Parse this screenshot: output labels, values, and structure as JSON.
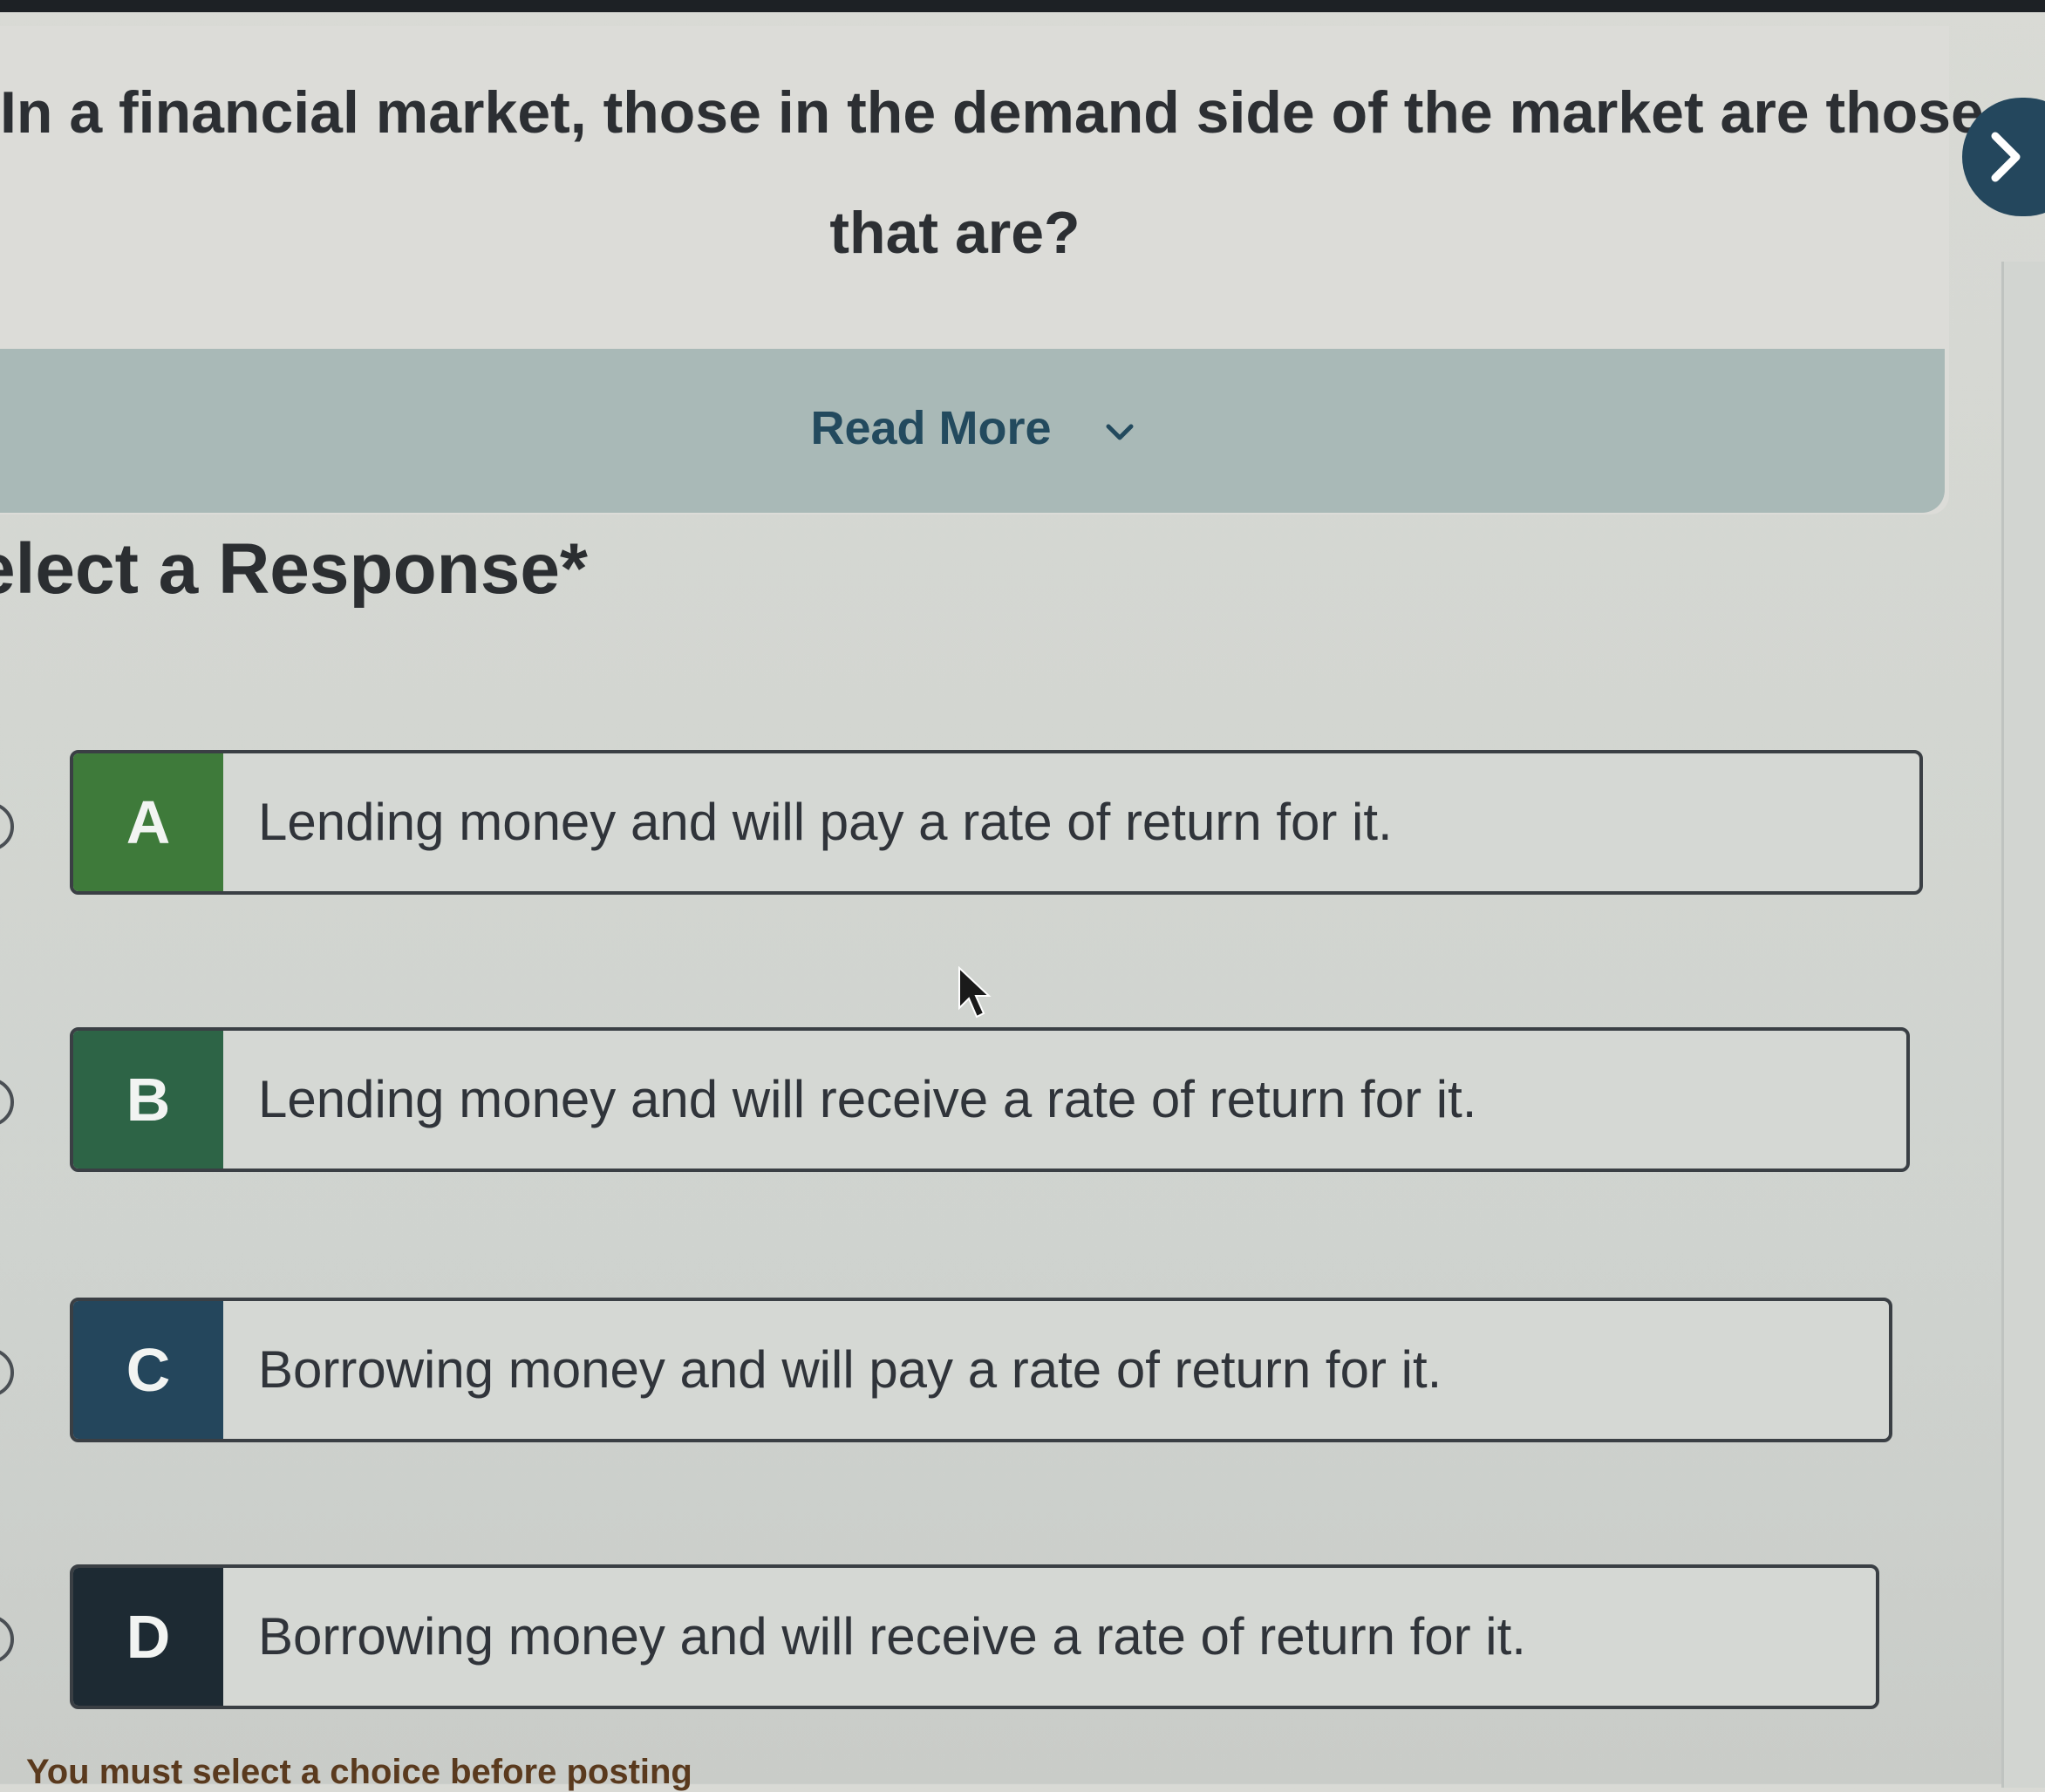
{
  "question": {
    "line1": "In a financial market, those in the demand side of the market are those",
    "line2": "that are?",
    "read_more_label": "Read More"
  },
  "response": {
    "title": "elect a Response*"
  },
  "options": [
    {
      "letter": "A",
      "text": "Lending money and will pay a rate of return for it."
    },
    {
      "letter": "B",
      "text": "Lending money and will receive a rate of return for it."
    },
    {
      "letter": "C",
      "text": "Borrowing money and will pay a rate of return for it."
    },
    {
      "letter": "D",
      "text": "Borrowing money and will receive a rate of return for it."
    }
  ],
  "footer": {
    "warning": "You must select a choice before posting"
  },
  "icons": {
    "next": "chevron-right-icon",
    "read_more": "chevron-down-icon"
  },
  "colors": {
    "option_a": "#3e7a3a",
    "option_b": "#2d6446",
    "option_c": "#24465c",
    "option_d": "#1d2a33",
    "accent": "#24475d"
  }
}
